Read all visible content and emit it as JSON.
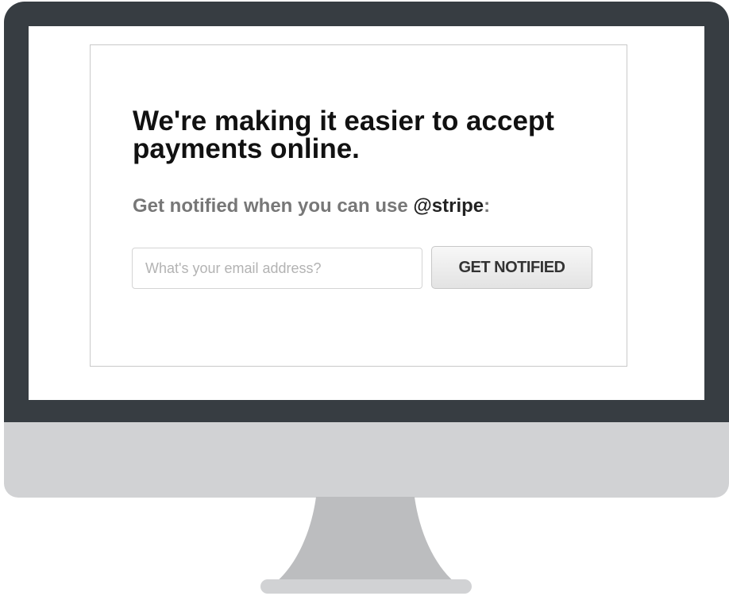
{
  "card": {
    "headline": "We're making it easier to accept payments online.",
    "subline_prefix": "Get notified when you can use ",
    "subline_handle": "@stripe",
    "subline_suffix": ":",
    "email": {
      "value": "",
      "placeholder": "What's your email address?"
    },
    "notify_button_label": "GET NOTIFIED"
  },
  "colors": {
    "bezel": "#373d42",
    "chin": "#d1d2d4",
    "stand": "#bcbdbf",
    "stand_base": "#d1d2d4",
    "screen": "#ffffff",
    "headline": "#111111",
    "subline": "#777777",
    "handle": "#222222"
  }
}
